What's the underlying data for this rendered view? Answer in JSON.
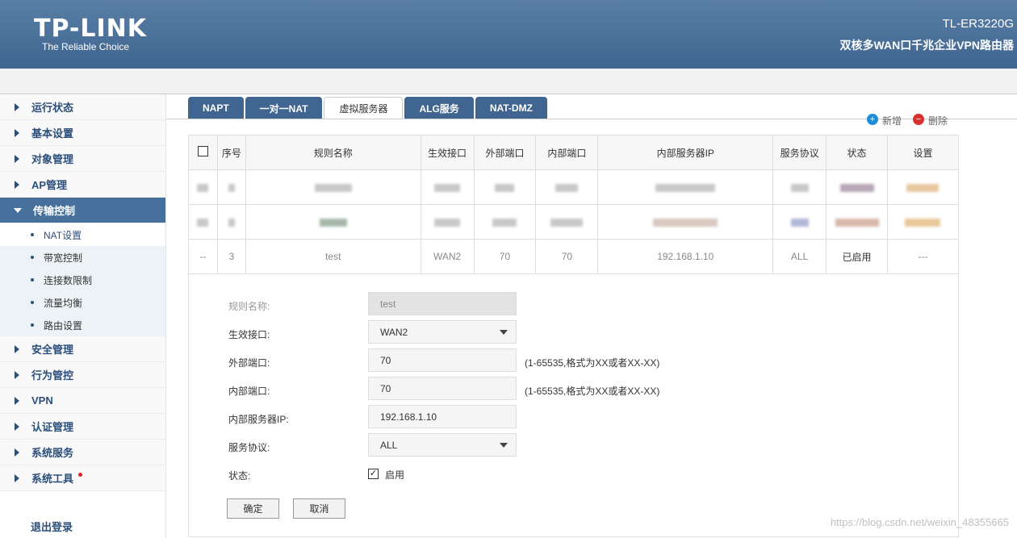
{
  "header": {
    "logo": "TP-LINK",
    "tagline": "The Reliable Choice",
    "model": "TL-ER3220G",
    "model_desc": "双核多WAN口千兆企业VPN路由器"
  },
  "sidebar": {
    "items": [
      {
        "label": "运行状态"
      },
      {
        "label": "基本设置"
      },
      {
        "label": "对象管理"
      },
      {
        "label": "AP管理"
      },
      {
        "label": "传输控制"
      },
      {
        "label": "安全管理"
      },
      {
        "label": "行为管控"
      },
      {
        "label": "VPN"
      },
      {
        "label": "认证管理"
      },
      {
        "label": "系统服务"
      },
      {
        "label": "系统工具"
      }
    ],
    "subitems": [
      {
        "label": "NAT设置"
      },
      {
        "label": "带宽控制"
      },
      {
        "label": "连接数限制"
      },
      {
        "label": "流量均衡"
      },
      {
        "label": "路由设置"
      }
    ],
    "logout": "退出登录"
  },
  "tabs": [
    "NAPT",
    "一对一NAT",
    "虚拟服务器",
    "ALG服务",
    "NAT-DMZ"
  ],
  "actions": {
    "add": "新增",
    "delete": "删除"
  },
  "table": {
    "headers": [
      "序号",
      "规则名称",
      "生效接口",
      "外部端口",
      "内部端口",
      "内部服务器IP",
      "服务协议",
      "状态",
      "设置"
    ],
    "edit_row": {
      "select": "--",
      "index": "3",
      "name": "test",
      "interface": "WAN2",
      "ext_port": "70",
      "int_port": "70",
      "server_ip": "192.168.1.10",
      "protocol": "ALL",
      "status": "已启用",
      "settings": "---"
    }
  },
  "form": {
    "name_label": "规则名称:",
    "name_value": "test",
    "interface_label": "生效接口:",
    "interface_value": "WAN2",
    "ext_port_label": "外部端口:",
    "ext_port_value": "70",
    "ext_port_hint": "(1-65535,格式为XX或者XX-XX)",
    "int_port_label": "内部端口:",
    "int_port_value": "70",
    "int_port_hint": "(1-65535,格式为XX或者XX-XX)",
    "server_ip_label": "内部服务器IP:",
    "server_ip_value": "192.168.1.10",
    "protocol_label": "服务协议:",
    "protocol_value": "ALL",
    "status_label": "状态:",
    "status_check_label": "启用",
    "ok_button": "确定",
    "cancel_button": "取消"
  },
  "watermark": "https://blog.csdn.net/weixin_48355665",
  "colors": {
    "header": "#3f6590",
    "nav_text": "#2b4f7a",
    "add_icon": "#1e8fd6",
    "delete_icon": "#d93030"
  }
}
